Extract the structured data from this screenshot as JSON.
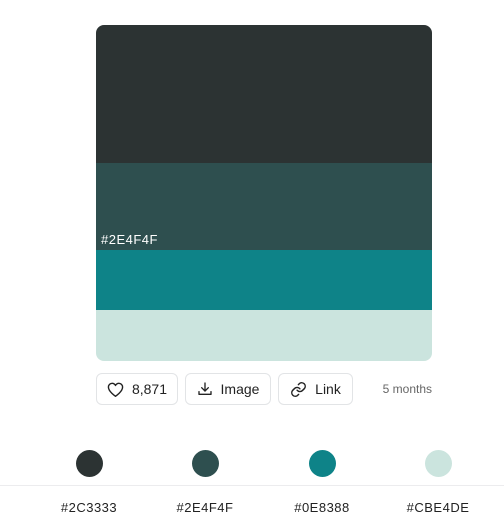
{
  "palette": {
    "colors": [
      "#2C3333",
      "#2E4F4F",
      "#0E8388",
      "#CBE4DE"
    ],
    "hover_label": "#2E4F4F"
  },
  "actions": {
    "like_count": "8,871",
    "image_label": "Image",
    "link_label": "Link",
    "age": "5 months"
  },
  "swatches": [
    {
      "hex": "#2C3333"
    },
    {
      "hex": "#2E4F4F"
    },
    {
      "hex": "#0E8388"
    },
    {
      "hex": "#CBE4DE"
    }
  ]
}
